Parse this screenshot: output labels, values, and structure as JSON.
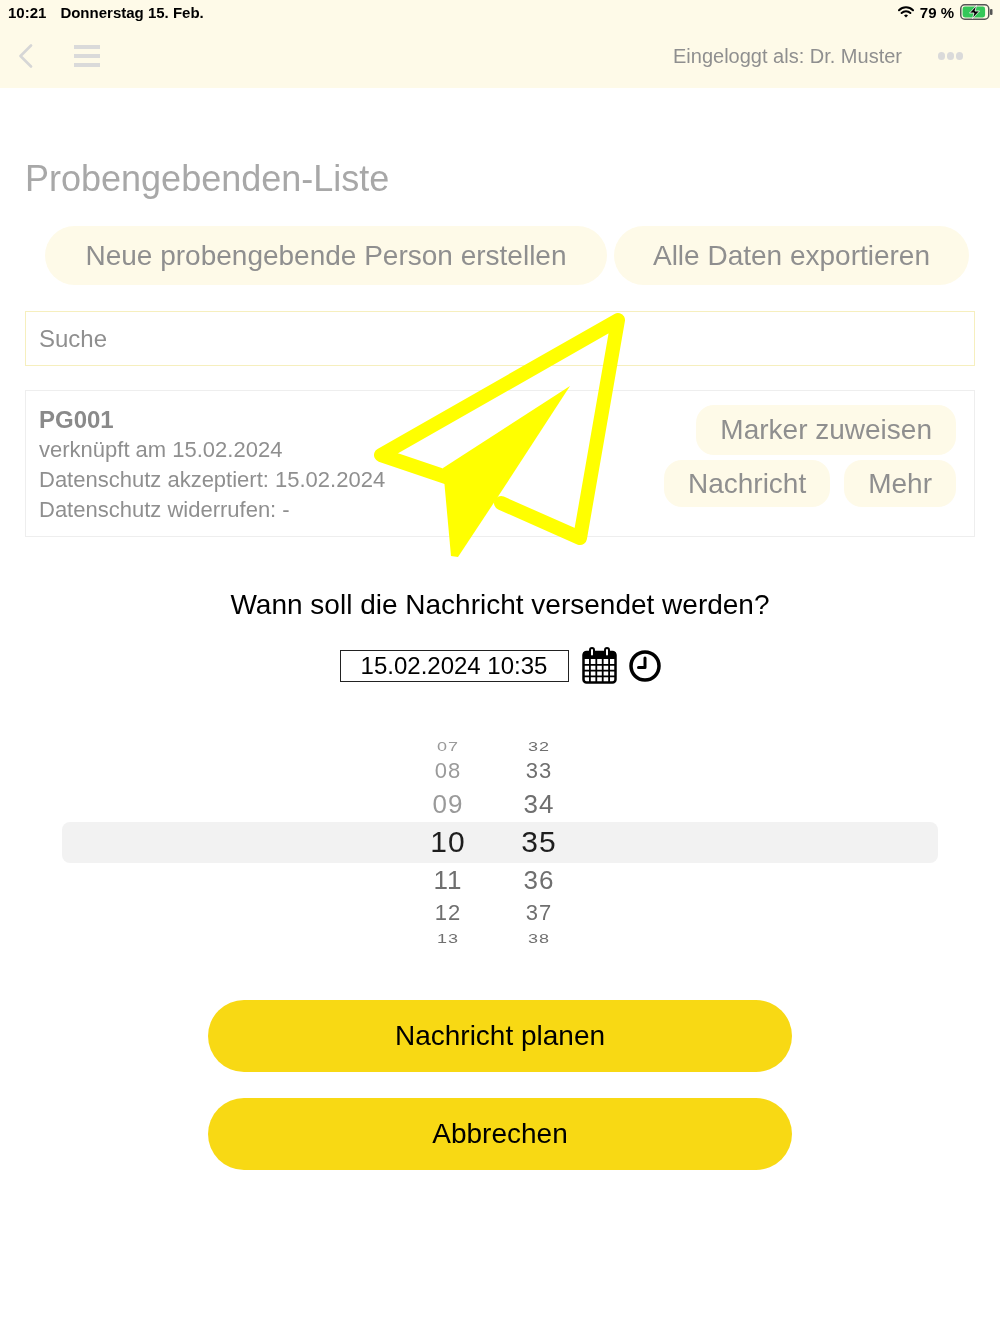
{
  "status_bar": {
    "time": "10:21",
    "date": "Donnerstag 15. Feb.",
    "battery": "79 %"
  },
  "nav_bar": {
    "user_label": "Eingeloggt als: Dr. Muster"
  },
  "page": {
    "title": "Probengebenden-Liste",
    "actions": [
      "Neue probengebende Person erstellen",
      "Alle Daten exportieren"
    ],
    "search": {
      "placeholder": "Suche"
    },
    "participants": [
      {
        "id": "PG001",
        "details": [
          "verknüpft am 15.02.2024",
          "Datenschutz akzeptiert: 15.02.2024",
          "Datenschutz widerrufen: -"
        ],
        "actions": [
          [
            "Marker zuweisen"
          ],
          [
            "Nachricht",
            "Mehr"
          ]
        ]
      }
    ]
  },
  "dialog": {
    "question": "Wann soll die Nachricht versendet werden?",
    "datetime_field": {
      "value": "15.02.2024 10:35"
    },
    "time_picker": {
      "hours": [
        {
          "label": "07",
          "selected": false,
          "disabled": true
        },
        {
          "label": "08",
          "selected": false,
          "disabled": true
        },
        {
          "label": "09",
          "selected": false,
          "disabled": true
        },
        {
          "label": "10",
          "selected": true,
          "disabled": false
        },
        {
          "label": "11",
          "selected": false,
          "disabled": false
        },
        {
          "label": "12",
          "selected": false,
          "disabled": false
        },
        {
          "label": "13",
          "selected": false,
          "disabled": false
        }
      ],
      "minutes": [
        {
          "label": "32",
          "selected": false,
          "disabled": false
        },
        {
          "label": "33",
          "selected": false,
          "disabled": false
        },
        {
          "label": "34",
          "selected": false,
          "disabled": false
        },
        {
          "label": "35",
          "selected": true,
          "disabled": false
        },
        {
          "label": "36",
          "selected": false,
          "disabled": false
        },
        {
          "label": "37",
          "selected": false,
          "disabled": false
        },
        {
          "label": "38",
          "selected": false,
          "disabled": false
        }
      ]
    },
    "buttons": [
      "Nachricht planen",
      "Abbrechen"
    ]
  }
}
